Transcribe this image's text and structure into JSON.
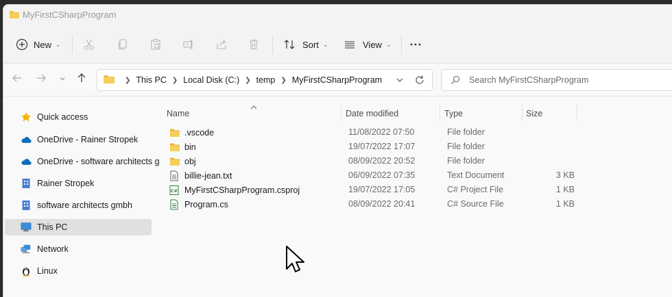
{
  "window": {
    "title": "MyFirstCSharpProgram"
  },
  "toolbar": {
    "new_label": "New",
    "sort_label": "Sort",
    "view_label": "View",
    "more_label": "..."
  },
  "address": {
    "crumbs": [
      "This PC",
      "Local Disk (C:)",
      "temp",
      "MyFirstCSharpProgram"
    ]
  },
  "search": {
    "placeholder": "Search MyFirstCSharpProgram"
  },
  "sidebar": {
    "items": [
      {
        "label": "Quick access",
        "icon": "star-icon",
        "selected": false
      },
      {
        "label": "OneDrive - Rainer Stropek",
        "icon": "cloud-icon",
        "selected": false
      },
      {
        "label": "OneDrive - software architects g",
        "icon": "cloud-icon",
        "selected": false
      },
      {
        "label": "Rainer Stropek",
        "icon": "building-icon",
        "selected": false
      },
      {
        "label": "software architects gmbh",
        "icon": "building-icon",
        "selected": false
      },
      {
        "label": "This PC",
        "icon": "monitor-icon",
        "selected": true
      },
      {
        "label": "Network",
        "icon": "network-icon",
        "selected": false
      },
      {
        "label": "Linux",
        "icon": "penguin-icon",
        "selected": false
      }
    ]
  },
  "columns": {
    "name": "Name",
    "date": "Date modified",
    "type": "Type",
    "size": "Size"
  },
  "files": [
    {
      "name": ".vscode",
      "date": "11/08/2022 07:50",
      "type": "File folder",
      "size": "",
      "icon": "folder-icon"
    },
    {
      "name": "bin",
      "date": "19/07/2022 17:07",
      "type": "File folder",
      "size": "",
      "icon": "folder-icon"
    },
    {
      "name": "obj",
      "date": "08/09/2022 20:52",
      "type": "File folder",
      "size": "",
      "icon": "folder-icon"
    },
    {
      "name": "billie-jean.txt",
      "date": "06/09/2022 07:35",
      "type": "Text Document",
      "size": "3 KB",
      "icon": "text-file-icon"
    },
    {
      "name": "MyFirstCSharpProgram.csproj",
      "date": "19/07/2022 17:05",
      "type": "C# Project File",
      "size": "1 KB",
      "icon": "csproj-file-icon"
    },
    {
      "name": "Program.cs",
      "date": "08/09/2022 20:41",
      "type": "C# Source File",
      "size": "1 KB",
      "icon": "cs-file-icon"
    }
  ],
  "colors": {
    "folder": "#f0c24b",
    "selected": "#e0e0e0",
    "onedrive": "#0f6cbd",
    "csfile": "#2e7d32"
  }
}
